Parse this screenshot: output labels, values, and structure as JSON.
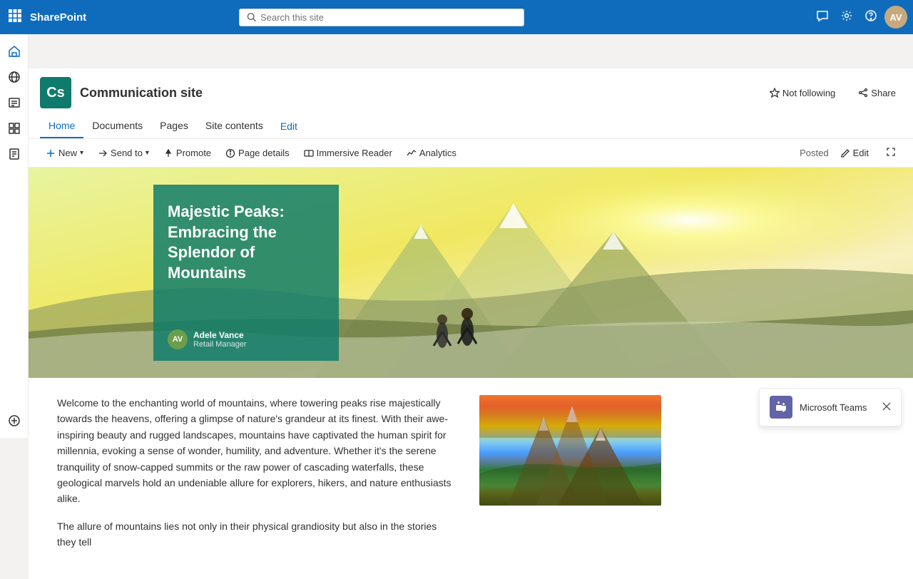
{
  "topbar": {
    "app_name": "SharePoint",
    "search_placeholder": "Search this site"
  },
  "site": {
    "logo_initials": "Cs",
    "name": "Communication site",
    "not_following_label": "Not following",
    "share_label": "Share"
  },
  "nav": {
    "items": [
      {
        "label": "Home",
        "active": true
      },
      {
        "label": "Documents",
        "active": false
      },
      {
        "label": "Pages",
        "active": false
      },
      {
        "label": "Site contents",
        "active": false
      },
      {
        "label": "Edit",
        "active": false
      }
    ]
  },
  "toolbar": {
    "new_label": "New",
    "send_to_label": "Send to",
    "promote_label": "Promote",
    "page_details_label": "Page details",
    "immersive_reader_label": "Immersive Reader",
    "analytics_label": "Analytics",
    "posted_label": "Posted",
    "edit_label": "Edit"
  },
  "hero": {
    "title": "Majestic Peaks: Embracing the Splendor of Mountains",
    "author_initials": "AV",
    "author_name": "Adele Vance",
    "author_role": "Retail Manager"
  },
  "content": {
    "paragraph1": "Welcome to the enchanting world of mountains, where towering peaks rise majestically towards the heavens, offering a glimpse of nature's grandeur at its finest. With their awe-inspiring beauty and rugged landscapes, mountains have captivated the human spirit for millennia, evoking a sense of wonder, humility, and adventure. Whether it's the serene tranquility of snow-capped summits or the raw power of cascading waterfalls, these geological marvels hold an undeniable allure for explorers, hikers, and nature enthusiasts alike.",
    "paragraph2": "The allure of mountains lies not only in their physical grandiosity but also in the stories they tell"
  },
  "teams": {
    "label": "Microsoft Teams"
  },
  "sidebar": {
    "icons": [
      "home",
      "globe",
      "search",
      "layers",
      "list",
      "plus"
    ]
  }
}
